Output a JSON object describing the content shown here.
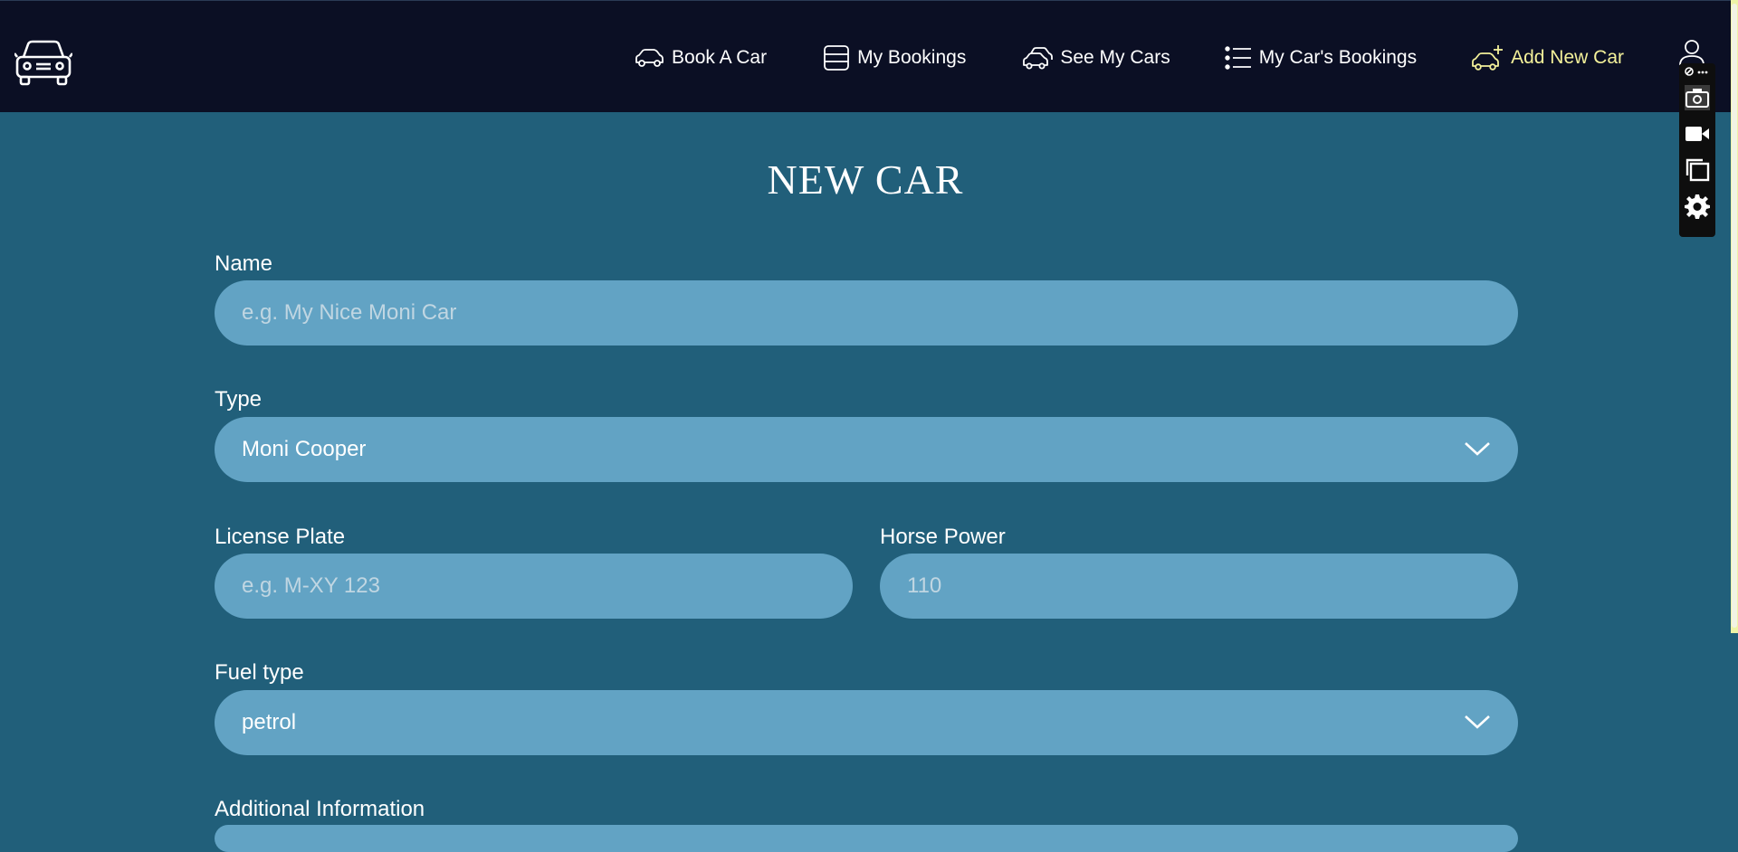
{
  "nav": {
    "items": [
      {
        "label": "Book A Car",
        "icon": "car-icon"
      },
      {
        "label": "My Bookings",
        "icon": "list-box-icon"
      },
      {
        "label": "See My Cars",
        "icon": "cars-icon"
      },
      {
        "label": "My Car's Bookings",
        "icon": "bullet-list-icon"
      },
      {
        "label": "Add New Car",
        "icon": "car-plus-icon",
        "active": true
      }
    ],
    "active_color": "#f4f19a"
  },
  "page": {
    "title": "NEW CAR"
  },
  "form": {
    "name": {
      "label": "Name",
      "placeholder": "e.g. My Nice Moni Car"
    },
    "type": {
      "label": "Type",
      "value": "Moni Cooper"
    },
    "license_plate": {
      "label": "License Plate",
      "placeholder": "e.g. M-XY 123"
    },
    "horse_power": {
      "label": "Horse Power",
      "placeholder": "110"
    },
    "fuel_type": {
      "label": "Fuel type",
      "value": "petrol"
    },
    "additional_info": {
      "label": "Additional Information"
    }
  },
  "toolbar": {
    "icons": [
      "pin-icon",
      "camera-icon",
      "video-icon",
      "windows-icon",
      "gear-icon"
    ]
  },
  "colors": {
    "navbar": "#0b0f24",
    "background": "#215f7a",
    "field": "#62a3c4",
    "placeholder": "#c0d6e2"
  }
}
